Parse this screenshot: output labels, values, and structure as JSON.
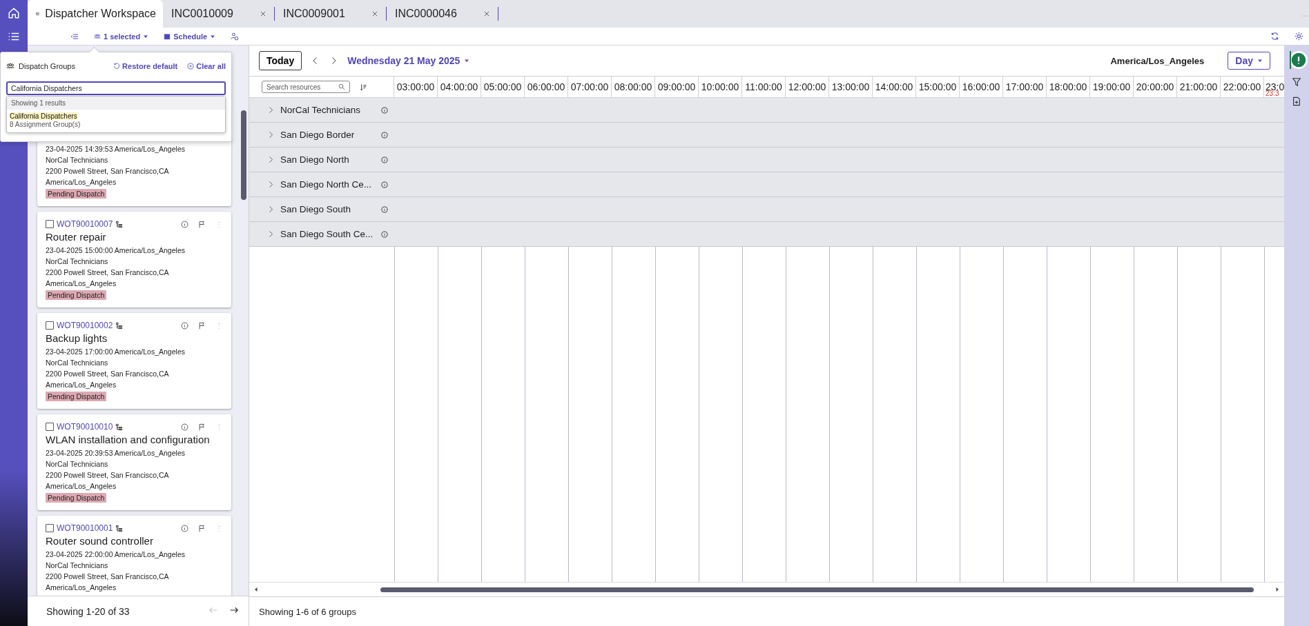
{
  "tabs": [
    {
      "label": "Dispatcher Workspace",
      "selected": true,
      "closable": false
    },
    {
      "label": "INC0010009",
      "selected": false,
      "closable": true
    },
    {
      "label": "INC0009001",
      "selected": false,
      "closable": true
    },
    {
      "label": "INC0000046",
      "selected": false,
      "closable": true
    }
  ],
  "toolbar": {
    "selection": "1 selected",
    "view": "Schedule"
  },
  "dispatch_groups": {
    "title": "Dispatch Groups",
    "restore": "Restore default",
    "clear": "Clear all",
    "search_value": "California Dispatchers",
    "results_count": "Showing 1 results",
    "results": [
      {
        "name": "California Dispatchers",
        "detail": "8 Assignment Group(s)"
      }
    ]
  },
  "work_orders": [
    {
      "datetime": "23-04-2025 14:39:53 America/Los_Angeles",
      "group": "NorCal Technicians",
      "address": "2200 Powell Street, San Francisco,CA",
      "timezone": "America/Los_Angeles",
      "status": "Pending Dispatch"
    },
    {
      "number": "WOT90010007",
      "checked": false,
      "title": "Router repair",
      "datetime": "23-04-2025 15:00:00 America/Los_Angeles",
      "group": "NorCal Technicians",
      "address": "2200 Powell Street, San Francisco,CA",
      "timezone": "America/Los_Angeles",
      "status": "Pending Dispatch"
    },
    {
      "number": "WOT90010002",
      "checked": false,
      "title": "Backup lights",
      "datetime": "23-04-2025 17:00:00 America/Los_Angeles",
      "group": "NorCal Technicians",
      "address": "2200 Powell Street, San Francisco,CA",
      "timezone": "America/Los_Angeles",
      "status": "Pending Dispatch"
    },
    {
      "number": "WOT90010010",
      "checked": false,
      "title": "WLAN installation and configuration",
      "datetime": "23-04-2025 20:39:53 America/Los_Angeles",
      "group": "NorCal Technicians",
      "address": "2200 Powell Street, San Francisco,CA",
      "timezone": "America/Los_Angeles",
      "status": "Pending Dispatch"
    },
    {
      "number": "WOT90010001",
      "checked": false,
      "title": "Router sound controller",
      "datetime": "23-04-2025 22:00:00 America/Los_Angeles",
      "group": "NorCal Technicians",
      "address": "2200 Powell Street, San Francisco,CA",
      "timezone": "America/Los_Angeles"
    }
  ],
  "pagination": {
    "text": "Showing 1-20 of 33",
    "prev_disabled": true,
    "next_disabled": false
  },
  "schedule": {
    "today": "Today",
    "date": "Wednesday 21 May 2025",
    "timezone": "America/Los_Angeles",
    "view": "Day",
    "search_placeholder": "Search resources",
    "hours": [
      "03:00:00",
      "04:00:00",
      "05:00:00",
      "06:00:00",
      "07:00:00",
      "08:00:00",
      "09:00:00",
      "10:00:00",
      "11:00:00",
      "12:00:00",
      "13:00:00",
      "14:00:00",
      "15:00:00",
      "16:00:00",
      "17:00:00",
      "18:00:00",
      "19:00:00",
      "20:00:00",
      "21:00:00",
      "22:00:00",
      "23:0"
    ],
    "current_time": "23:3",
    "groups": [
      {
        "name": "NorCal Technicians",
        "expanded": false
      },
      {
        "name": "San Diego Border",
        "expanded": false
      },
      {
        "name": "San Diego North",
        "expanded": false
      },
      {
        "name": "San Diego North Ce...",
        "expanded": false
      },
      {
        "name": "San Diego South",
        "expanded": false
      },
      {
        "name": "San Diego South Ce...",
        "expanded": false
      }
    ],
    "footer": "Showing 1-6 of 6 groups"
  },
  "side_panel": [
    {
      "kind": "info",
      "selected": true
    },
    {
      "kind": "filter",
      "selected": false
    },
    {
      "kind": "document",
      "selected": false
    }
  ]
}
